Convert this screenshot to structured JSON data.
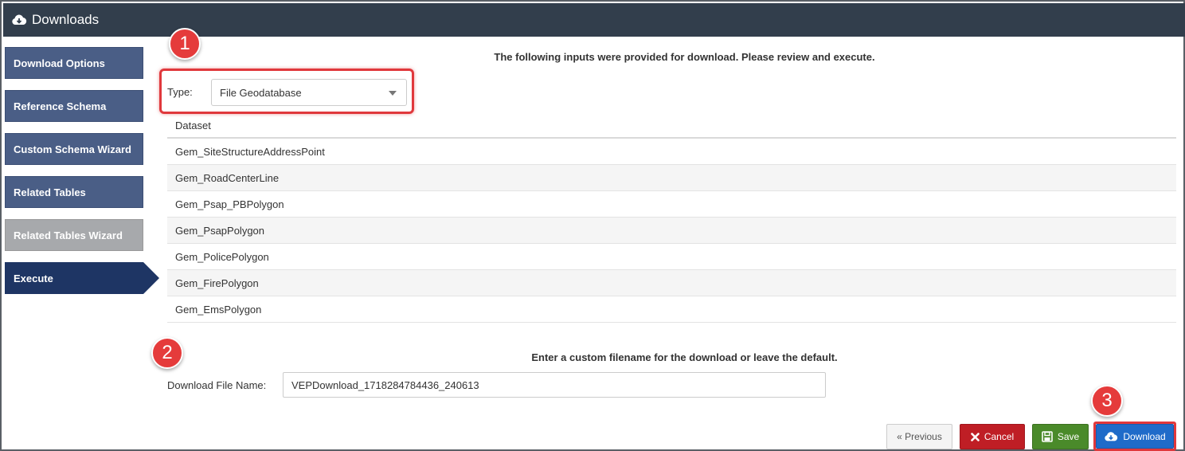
{
  "window": {
    "title": "Downloads",
    "title_icon": "cloud-download-icon"
  },
  "sidebar": {
    "items": [
      {
        "label": "Download Options",
        "state": "normal"
      },
      {
        "label": "Reference Schema",
        "state": "normal"
      },
      {
        "label": "Custom Schema Wizard",
        "state": "normal"
      },
      {
        "label": "Related Tables",
        "state": "normal"
      },
      {
        "label": "Related Tables Wizard",
        "state": "disabled"
      },
      {
        "label": "Execute",
        "state": "active"
      }
    ]
  },
  "main": {
    "review_heading": "The following inputs were provided for download. Please review and execute.",
    "type_label": "Type:",
    "type_value": "File Geodatabase",
    "table": {
      "header": "Dataset",
      "rows": [
        "Gem_SiteStructureAddressPoint",
        "Gem_RoadCenterLine",
        "Gem_Psap_PBPolygon",
        "Gem_PsapPolygon",
        "Gem_PolicePolygon",
        "Gem_FirePolygon",
        "Gem_EmsPolygon"
      ]
    },
    "filename_heading": "Enter a custom filename for the download or leave the default.",
    "filename_label": "Download File Name:",
    "filename_value": "VEPDownload_1718284784436_240613"
  },
  "buttons": {
    "previous": "« Previous",
    "cancel": "Cancel",
    "save": "Save",
    "download": "Download"
  },
  "annotations": {
    "badge1": "1",
    "badge2": "2",
    "badge3": "3"
  },
  "colors": {
    "titlebar": "#323e4c",
    "step": "#4a5e86",
    "step_active": "#1e3564",
    "step_disabled": "#a7a9ac",
    "cancel": "#bf1e25",
    "save": "#4a8a2a",
    "download": "#1f6bc9",
    "highlight": "#e0383c"
  }
}
